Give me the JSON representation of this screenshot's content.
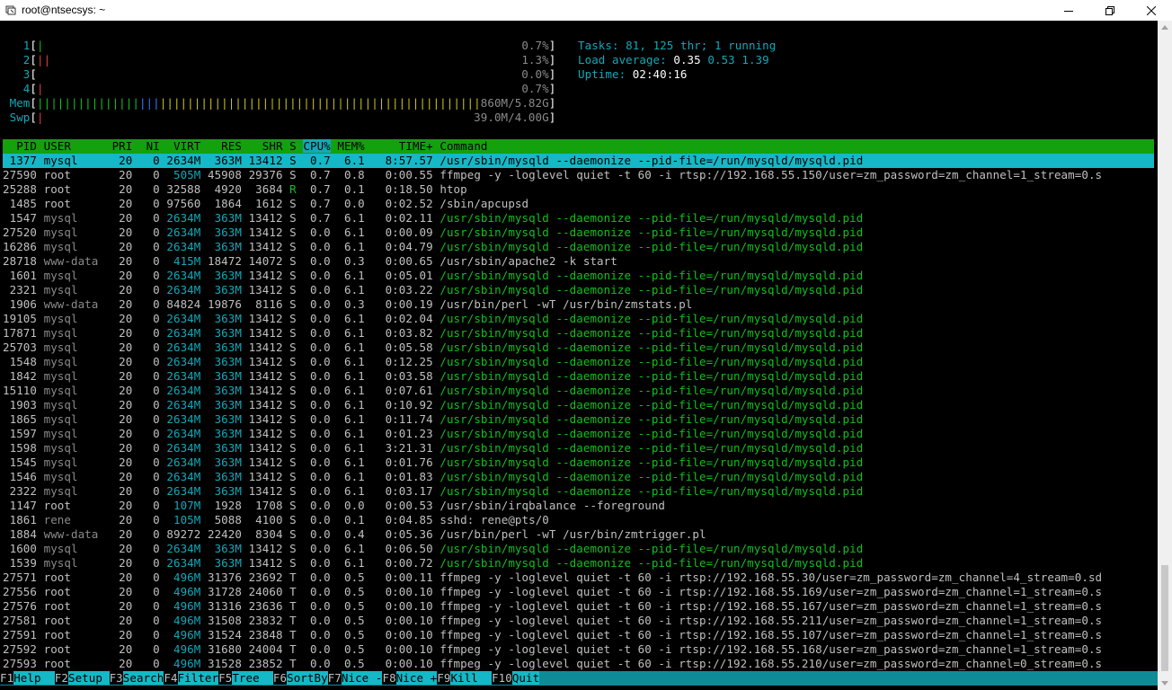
{
  "window": {
    "title": "root@ntsecsys: ~",
    "controls": [
      "minimize",
      "maximize",
      "close"
    ]
  },
  "meters": {
    "cpus": [
      {
        "label": "1",
        "bar": "|",
        "bar_class": "grn",
        "value": "0.7%"
      },
      {
        "label": "2",
        "bar": "||",
        "bar_class": "red",
        "value": "1.3%"
      },
      {
        "label": "3",
        "bar": "",
        "bar_class": "grn",
        "value": "0.0%"
      },
      {
        "label": "4",
        "bar": "|",
        "bar_class": "red",
        "value": "0.7%"
      }
    ],
    "mem": {
      "label": "Mem",
      "value": "860M/5.82G"
    },
    "swp": {
      "label": "Swp",
      "value": "39.0M/4.00G"
    }
  },
  "stats": {
    "tasks_label": "Tasks:",
    "tasks": "81,",
    "thr": "125",
    "thr_label": "thr;",
    "running": "1",
    "running_label": "running",
    "load_label": "Load average:",
    "load1": "0.35",
    "load5": "0.53",
    "load15": "1.39",
    "uptime_label": "Uptime:",
    "uptime": "02:40:16"
  },
  "columns": [
    "PID",
    "USER",
    "PRI",
    "NI",
    "VIRT",
    "RES",
    "SHR",
    "S",
    "CPU%",
    "MEM%",
    "TIME+",
    "Command"
  ],
  "sort_column": "CPU%",
  "processes": [
    {
      "pid": "1377",
      "user": "mysql",
      "pri": "20",
      "ni": "0",
      "virt": "2634M",
      "res": "363M",
      "shr": "13412",
      "s": "S",
      "cpu": "0.7",
      "mem": "6.1",
      "time": "8:57.57",
      "cmd": "/usr/sbin/mysqld --daemonize --pid-file=/run/mysqld/mysqld.pid",
      "thread": false,
      "selected": true
    },
    {
      "pid": "27590",
      "user": "root",
      "pri": "20",
      "ni": "0",
      "virt": "505M",
      "res": "45908",
      "shr": "29376",
      "s": "S",
      "cpu": "0.7",
      "mem": "0.8",
      "time": "0:00.55",
      "cmd": "ffmpeg -y -loglevel quiet -t 60 -i rtsp://192.168.55.150/user=zm_password=zm_channel=1_stream=0.s",
      "thread": false
    },
    {
      "pid": "25288",
      "user": "root",
      "pri": "20",
      "ni": "0",
      "virt": "32588",
      "res": "4920",
      "shr": "3684",
      "s": "R",
      "cpu": "0.7",
      "mem": "0.1",
      "time": "0:18.50",
      "cmd": "htop",
      "thread": false
    },
    {
      "pid": "1485",
      "user": "root",
      "pri": "20",
      "ni": "0",
      "virt": "97560",
      "res": "1864",
      "shr": "1612",
      "s": "S",
      "cpu": "0.7",
      "mem": "0.0",
      "time": "0:02.52",
      "cmd": "/sbin/apcupsd",
      "thread": false
    },
    {
      "pid": "1547",
      "user": "mysql",
      "pri": "20",
      "ni": "0",
      "virt": "2634M",
      "res": "363M",
      "shr": "13412",
      "s": "S",
      "cpu": "0.7",
      "mem": "6.1",
      "time": "0:02.11",
      "cmd": "/usr/sbin/mysqld --daemonize --pid-file=/run/mysqld/mysqld.pid",
      "thread": true
    },
    {
      "pid": "27520",
      "user": "mysql",
      "pri": "20",
      "ni": "0",
      "virt": "2634M",
      "res": "363M",
      "shr": "13412",
      "s": "S",
      "cpu": "0.0",
      "mem": "6.1",
      "time": "0:00.09",
      "cmd": "/usr/sbin/mysqld --daemonize --pid-file=/run/mysqld/mysqld.pid",
      "thread": true
    },
    {
      "pid": "16286",
      "user": "mysql",
      "pri": "20",
      "ni": "0",
      "virt": "2634M",
      "res": "363M",
      "shr": "13412",
      "s": "S",
      "cpu": "0.0",
      "mem": "6.1",
      "time": "0:04.79",
      "cmd": "/usr/sbin/mysqld --daemonize --pid-file=/run/mysqld/mysqld.pid",
      "thread": true
    },
    {
      "pid": "28718",
      "user": "www-data",
      "pri": "20",
      "ni": "0",
      "virt": "415M",
      "res": "18472",
      "shr": "14072",
      "s": "S",
      "cpu": "0.0",
      "mem": "0.3",
      "time": "0:00.65",
      "cmd": "/usr/sbin/apache2 -k start",
      "thread": false
    },
    {
      "pid": "1601",
      "user": "mysql",
      "pri": "20",
      "ni": "0",
      "virt": "2634M",
      "res": "363M",
      "shr": "13412",
      "s": "S",
      "cpu": "0.0",
      "mem": "6.1",
      "time": "0:05.01",
      "cmd": "/usr/sbin/mysqld --daemonize --pid-file=/run/mysqld/mysqld.pid",
      "thread": true
    },
    {
      "pid": "2321",
      "user": "mysql",
      "pri": "20",
      "ni": "0",
      "virt": "2634M",
      "res": "363M",
      "shr": "13412",
      "s": "S",
      "cpu": "0.0",
      "mem": "6.1",
      "time": "0:03.22",
      "cmd": "/usr/sbin/mysqld --daemonize --pid-file=/run/mysqld/mysqld.pid",
      "thread": true
    },
    {
      "pid": "1906",
      "user": "www-data",
      "pri": "20",
      "ni": "0",
      "virt": "84824",
      "res": "19876",
      "shr": "8116",
      "s": "S",
      "cpu": "0.0",
      "mem": "0.3",
      "time": "0:00.19",
      "cmd": "/usr/bin/perl -wT /usr/bin/zmstats.pl",
      "thread": false
    },
    {
      "pid": "19105",
      "user": "mysql",
      "pri": "20",
      "ni": "0",
      "virt": "2634M",
      "res": "363M",
      "shr": "13412",
      "s": "S",
      "cpu": "0.0",
      "mem": "6.1",
      "time": "0:02.04",
      "cmd": "/usr/sbin/mysqld --daemonize --pid-file=/run/mysqld/mysqld.pid",
      "thread": true
    },
    {
      "pid": "17871",
      "user": "mysql",
      "pri": "20",
      "ni": "0",
      "virt": "2634M",
      "res": "363M",
      "shr": "13412",
      "s": "S",
      "cpu": "0.0",
      "mem": "6.1",
      "time": "0:03.82",
      "cmd": "/usr/sbin/mysqld --daemonize --pid-file=/run/mysqld/mysqld.pid",
      "thread": true
    },
    {
      "pid": "25703",
      "user": "mysql",
      "pri": "20",
      "ni": "0",
      "virt": "2634M",
      "res": "363M",
      "shr": "13412",
      "s": "S",
      "cpu": "0.0",
      "mem": "6.1",
      "time": "0:05.58",
      "cmd": "/usr/sbin/mysqld --daemonize --pid-file=/run/mysqld/mysqld.pid",
      "thread": true
    },
    {
      "pid": "1548",
      "user": "mysql",
      "pri": "20",
      "ni": "0",
      "virt": "2634M",
      "res": "363M",
      "shr": "13412",
      "s": "S",
      "cpu": "0.0",
      "mem": "6.1",
      "time": "0:12.25",
      "cmd": "/usr/sbin/mysqld --daemonize --pid-file=/run/mysqld/mysqld.pid",
      "thread": true
    },
    {
      "pid": "1842",
      "user": "mysql",
      "pri": "20",
      "ni": "0",
      "virt": "2634M",
      "res": "363M",
      "shr": "13412",
      "s": "S",
      "cpu": "0.0",
      "mem": "6.1",
      "time": "0:03.58",
      "cmd": "/usr/sbin/mysqld --daemonize --pid-file=/run/mysqld/mysqld.pid",
      "thread": true
    },
    {
      "pid": "15110",
      "user": "mysql",
      "pri": "20",
      "ni": "0",
      "virt": "2634M",
      "res": "363M",
      "shr": "13412",
      "s": "S",
      "cpu": "0.0",
      "mem": "6.1",
      "time": "0:07.61",
      "cmd": "/usr/sbin/mysqld --daemonize --pid-file=/run/mysqld/mysqld.pid",
      "thread": true
    },
    {
      "pid": "1903",
      "user": "mysql",
      "pri": "20",
      "ni": "0",
      "virt": "2634M",
      "res": "363M",
      "shr": "13412",
      "s": "S",
      "cpu": "0.0",
      "mem": "6.1",
      "time": "0:10.92",
      "cmd": "/usr/sbin/mysqld --daemonize --pid-file=/run/mysqld/mysqld.pid",
      "thread": true
    },
    {
      "pid": "1865",
      "user": "mysql",
      "pri": "20",
      "ni": "0",
      "virt": "2634M",
      "res": "363M",
      "shr": "13412",
      "s": "S",
      "cpu": "0.0",
      "mem": "6.1",
      "time": "0:11.74",
      "cmd": "/usr/sbin/mysqld --daemonize --pid-file=/run/mysqld/mysqld.pid",
      "thread": true
    },
    {
      "pid": "1597",
      "user": "mysql",
      "pri": "20",
      "ni": "0",
      "virt": "2634M",
      "res": "363M",
      "shr": "13412",
      "s": "S",
      "cpu": "0.0",
      "mem": "6.1",
      "time": "0:01.23",
      "cmd": "/usr/sbin/mysqld --daemonize --pid-file=/run/mysqld/mysqld.pid",
      "thread": true
    },
    {
      "pid": "1598",
      "user": "mysql",
      "pri": "20",
      "ni": "0",
      "virt": "2634M",
      "res": "363M",
      "shr": "13412",
      "s": "S",
      "cpu": "0.0",
      "mem": "6.1",
      "time": "3:21.31",
      "cmd": "/usr/sbin/mysqld --daemonize --pid-file=/run/mysqld/mysqld.pid",
      "thread": true
    },
    {
      "pid": "1545",
      "user": "mysql",
      "pri": "20",
      "ni": "0",
      "virt": "2634M",
      "res": "363M",
      "shr": "13412",
      "s": "S",
      "cpu": "0.0",
      "mem": "6.1",
      "time": "0:01.76",
      "cmd": "/usr/sbin/mysqld --daemonize --pid-file=/run/mysqld/mysqld.pid",
      "thread": true
    },
    {
      "pid": "1546",
      "user": "mysql",
      "pri": "20",
      "ni": "0",
      "virt": "2634M",
      "res": "363M",
      "shr": "13412",
      "s": "S",
      "cpu": "0.0",
      "mem": "6.1",
      "time": "0:01.83",
      "cmd": "/usr/sbin/mysqld --daemonize --pid-file=/run/mysqld/mysqld.pid",
      "thread": true
    },
    {
      "pid": "2322",
      "user": "mysql",
      "pri": "20",
      "ni": "0",
      "virt": "2634M",
      "res": "363M",
      "shr": "13412",
      "s": "S",
      "cpu": "0.0",
      "mem": "6.1",
      "time": "0:03.17",
      "cmd": "/usr/sbin/mysqld --daemonize --pid-file=/run/mysqld/mysqld.pid",
      "thread": true
    },
    {
      "pid": "1147",
      "user": "root",
      "pri": "20",
      "ni": "0",
      "virt": "107M",
      "res": "1928",
      "shr": "1708",
      "s": "S",
      "cpu": "0.0",
      "mem": "0.0",
      "time": "0:00.53",
      "cmd": "/usr/sbin/irqbalance --foreground",
      "thread": false
    },
    {
      "pid": "1861",
      "user": "rene",
      "pri": "20",
      "ni": "0",
      "virt": "105M",
      "res": "5088",
      "shr": "4100",
      "s": "S",
      "cpu": "0.0",
      "mem": "0.1",
      "time": "0:04.85",
      "cmd": "sshd: rene@pts/0",
      "thread": false
    },
    {
      "pid": "1884",
      "user": "www-data",
      "pri": "20",
      "ni": "0",
      "virt": "89272",
      "res": "22420",
      "shr": "8304",
      "s": "S",
      "cpu": "0.0",
      "mem": "0.4",
      "time": "0:05.36",
      "cmd": "/usr/bin/perl -wT /usr/bin/zmtrigger.pl",
      "thread": false
    },
    {
      "pid": "1600",
      "user": "mysql",
      "pri": "20",
      "ni": "0",
      "virt": "2634M",
      "res": "363M",
      "shr": "13412",
      "s": "S",
      "cpu": "0.0",
      "mem": "6.1",
      "time": "0:06.50",
      "cmd": "/usr/sbin/mysqld --daemonize --pid-file=/run/mysqld/mysqld.pid",
      "thread": true
    },
    {
      "pid": "1539",
      "user": "mysql",
      "pri": "20",
      "ni": "0",
      "virt": "2634M",
      "res": "363M",
      "shr": "13412",
      "s": "S",
      "cpu": "0.0",
      "mem": "6.1",
      "time": "0:00.72",
      "cmd": "/usr/sbin/mysqld --daemonize --pid-file=/run/mysqld/mysqld.pid",
      "thread": true
    },
    {
      "pid": "27571",
      "user": "root",
      "pri": "20",
      "ni": "0",
      "virt": "496M",
      "res": "31376",
      "shr": "23692",
      "s": "T",
      "cpu": "0.0",
      "mem": "0.5",
      "time": "0:00.11",
      "cmd": "ffmpeg -y -loglevel quiet -t 60 -i rtsp://192.168.55.30/user=zm_password=zm_channel=4_stream=0.sd",
      "thread": false
    },
    {
      "pid": "27556",
      "user": "root",
      "pri": "20",
      "ni": "0",
      "virt": "496M",
      "res": "31728",
      "shr": "24060",
      "s": "T",
      "cpu": "0.0",
      "mem": "0.5",
      "time": "0:00.10",
      "cmd": "ffmpeg -y -loglevel quiet -t 60 -i rtsp://192.168.55.169/user=zm_password=zm_channel=1_stream=0.s",
      "thread": false
    },
    {
      "pid": "27576",
      "user": "root",
      "pri": "20",
      "ni": "0",
      "virt": "496M",
      "res": "31316",
      "shr": "23636",
      "s": "T",
      "cpu": "0.0",
      "mem": "0.5",
      "time": "0:00.10",
      "cmd": "ffmpeg -y -loglevel quiet -t 60 -i rtsp://192.168.55.167/user=zm_password=zm_channel=1_stream=0.s",
      "thread": false
    },
    {
      "pid": "27581",
      "user": "root",
      "pri": "20",
      "ni": "0",
      "virt": "496M",
      "res": "31508",
      "shr": "23832",
      "s": "T",
      "cpu": "0.0",
      "mem": "0.5",
      "time": "0:00.10",
      "cmd": "ffmpeg -y -loglevel quiet -t 60 -i rtsp://192.168.55.211/user=zm_password=zm_channel=1_stream=0.s",
      "thread": false
    },
    {
      "pid": "27591",
      "user": "root",
      "pri": "20",
      "ni": "0",
      "virt": "496M",
      "res": "31524",
      "shr": "23848",
      "s": "T",
      "cpu": "0.0",
      "mem": "0.5",
      "time": "0:00.10",
      "cmd": "ffmpeg -y -loglevel quiet -t 60 -i rtsp://192.168.55.107/user=zm_password=zm_channel=1_stream=0.s",
      "thread": false
    },
    {
      "pid": "27592",
      "user": "root",
      "pri": "20",
      "ni": "0",
      "virt": "496M",
      "res": "31680",
      "shr": "24004",
      "s": "T",
      "cpu": "0.0",
      "mem": "0.5",
      "time": "0:00.10",
      "cmd": "ffmpeg -y -loglevel quiet -t 60 -i rtsp://192.168.55.168/user=zm_password=zm_channel=1_stream=0.s",
      "thread": false
    },
    {
      "pid": "27593",
      "user": "root",
      "pri": "20",
      "ni": "0",
      "virt": "496M",
      "res": "31528",
      "shr": "23852",
      "s": "T",
      "cpu": "0.0",
      "mem": "0.5",
      "time": "0:00.10",
      "cmd": "ffmpeg -y -loglevel quiet -t 60 -i rtsp://192.168.55.210/user=zm_password=zm_channel=0_stream=0.s",
      "thread": false
    }
  ],
  "function_keys": [
    {
      "key": "F1",
      "label": "Help  "
    },
    {
      "key": "F2",
      "label": "Setup "
    },
    {
      "key": "F3",
      "label": "Search"
    },
    {
      "key": "F4",
      "label": "Filter"
    },
    {
      "key": "F5",
      "label": "Tree  "
    },
    {
      "key": "F6",
      "label": "SortBy"
    },
    {
      "key": "F7",
      "label": "Nice -"
    },
    {
      "key": "F8",
      "label": "Nice +"
    },
    {
      "key": "F9",
      "label": "Kill  "
    },
    {
      "key": "F10",
      "label": "Quit"
    }
  ]
}
